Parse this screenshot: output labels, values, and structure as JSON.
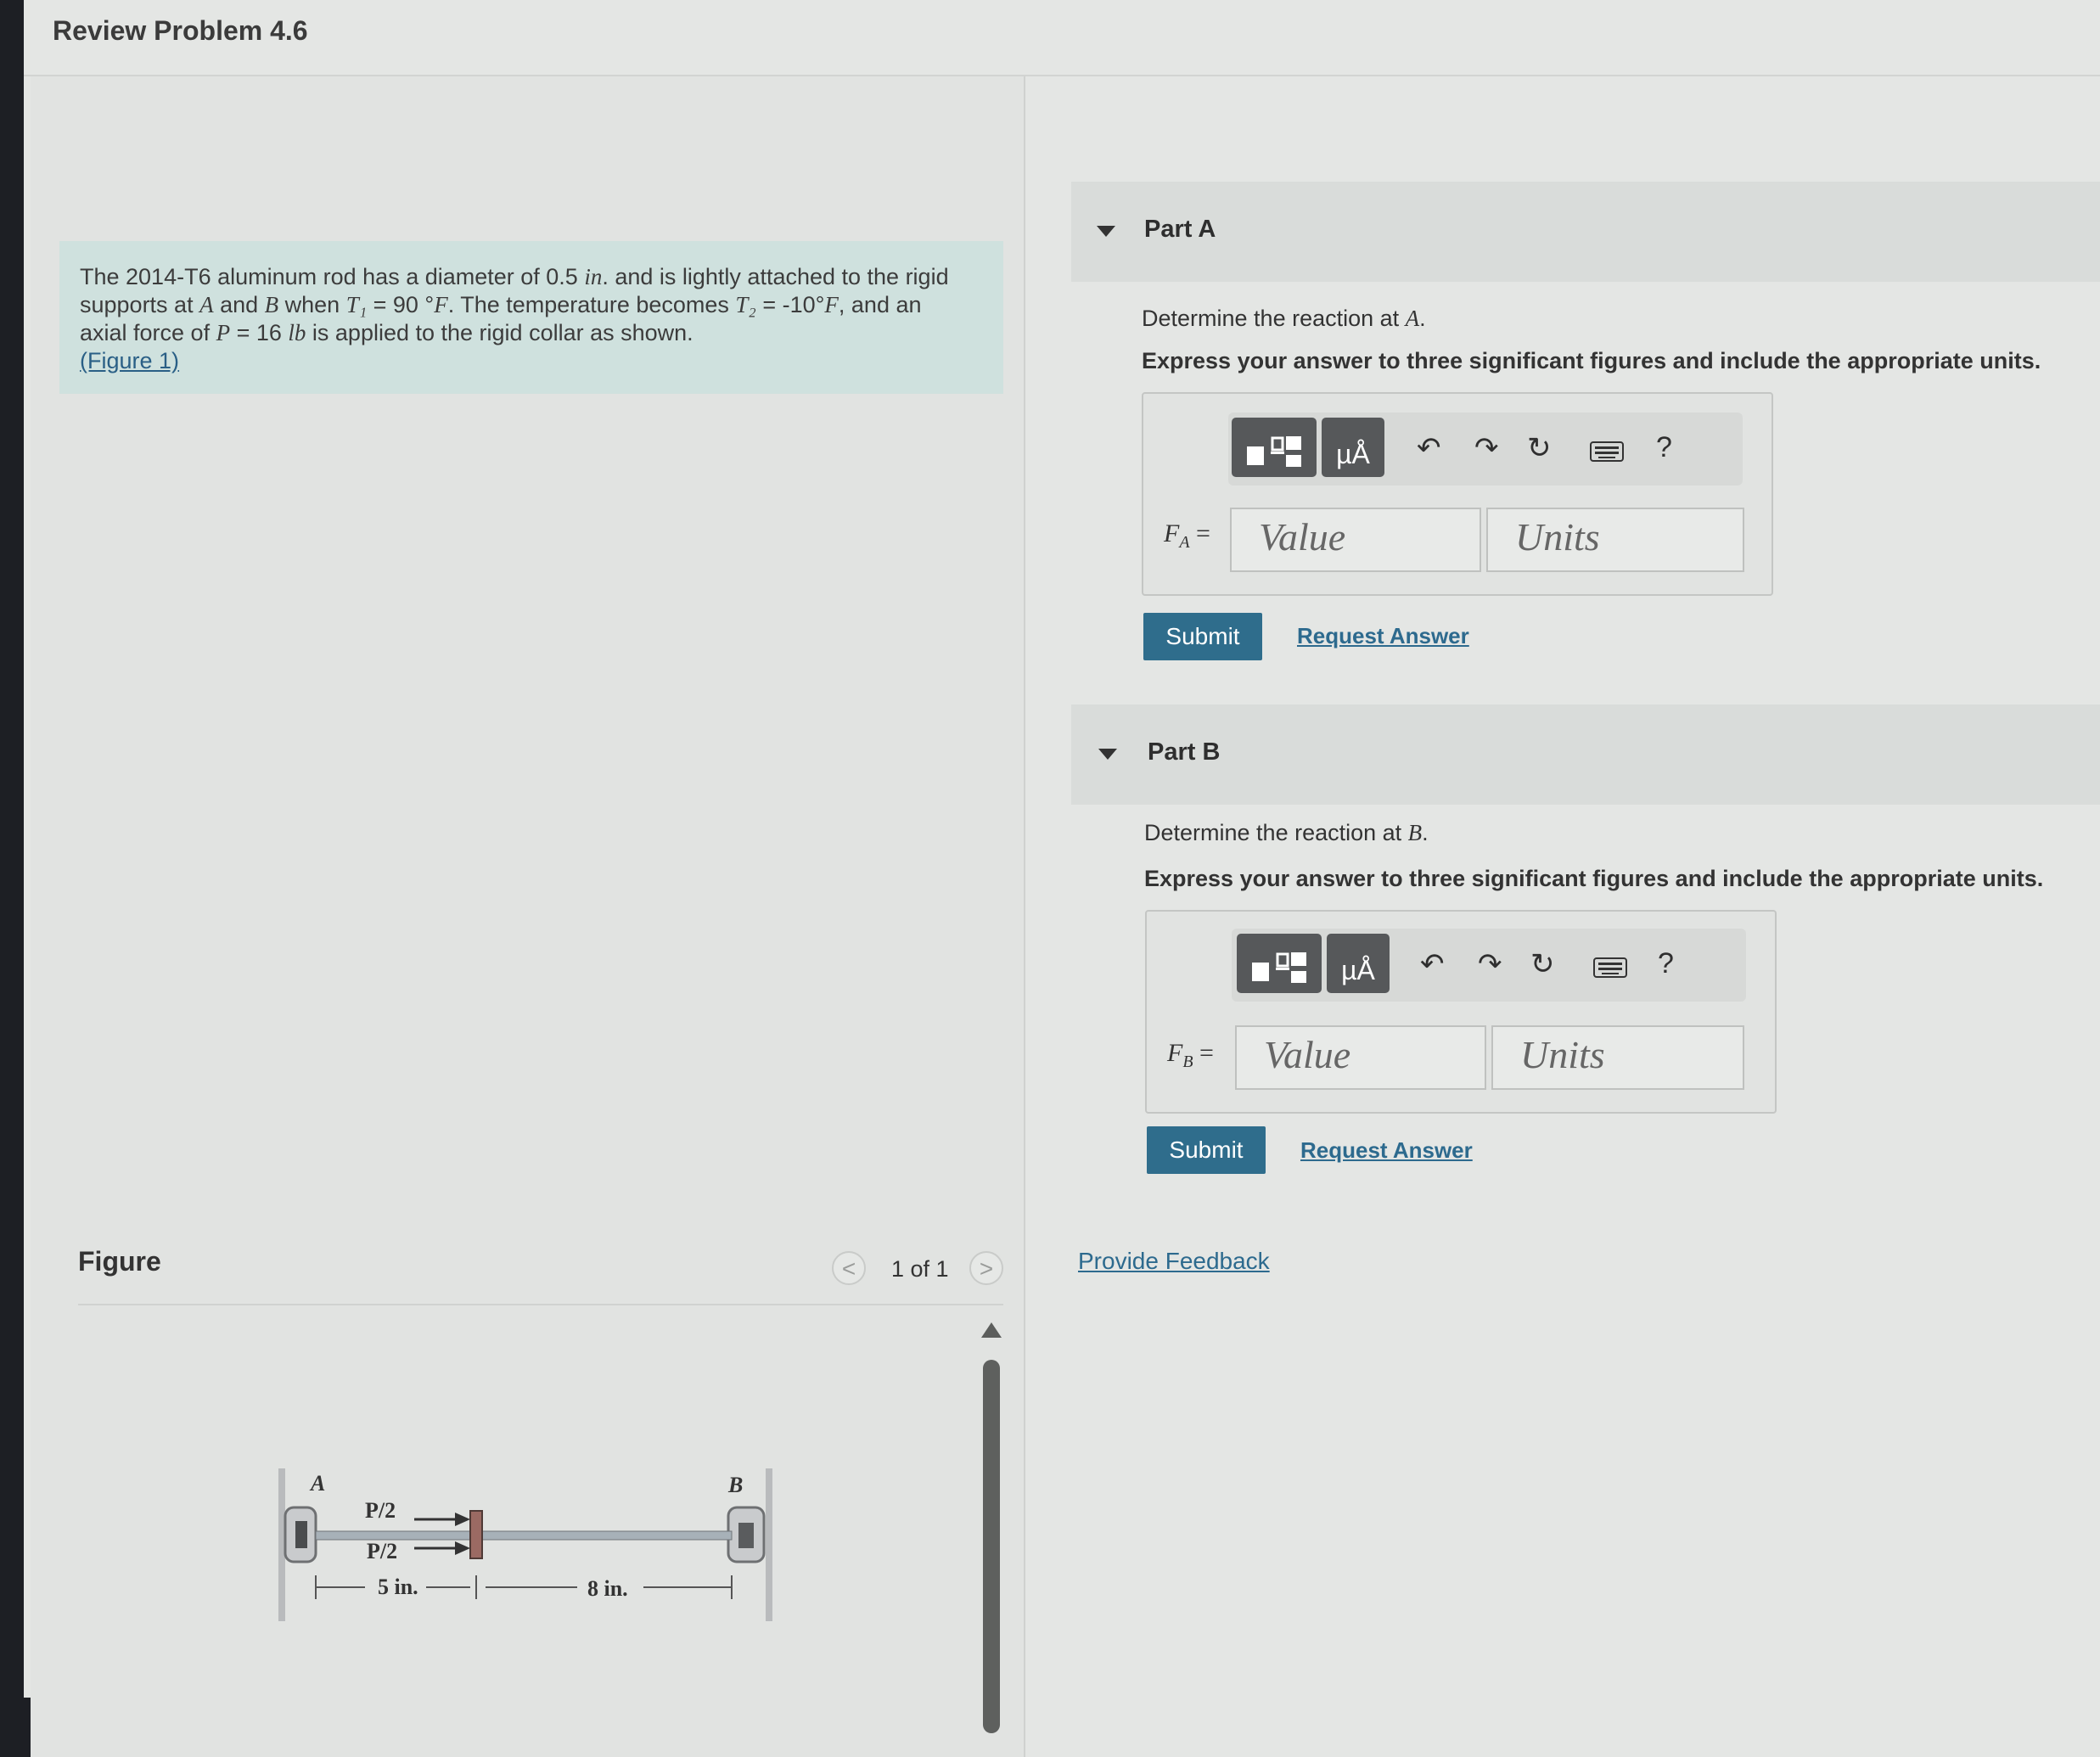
{
  "header": {
    "title": "Review Problem 4.6"
  },
  "problem": {
    "text1": "The 2014-T6 aluminum rod has a diameter of 0.5 ",
    "unit_in": "in",
    "text2": ". and is lightly attached to the rigid",
    "text3": "supports at ",
    "A": "A",
    "and": " and ",
    "B": "B",
    "when": " when ",
    "T1": "T₁",
    "t1val": " = 90 °",
    "F": "F",
    "text4": ". The temperature becomes ",
    "T2": "T₂",
    "t2val": " = -10°",
    "text5": ", and an",
    "text6": "axial force of ",
    "P": "P",
    "pval": " = 16 ",
    "lb": "lb",
    "text7": " is applied to the rigid collar as shown.",
    "figure_link": "(Figure 1)"
  },
  "figure": {
    "label": "Figure",
    "pager": "1 of 1",
    "prev": "<",
    "next": ">",
    "labels": {
      "A": "A",
      "B": "B",
      "p_top": "P/2",
      "p_bottom": "P/2",
      "dim1": "5 in.",
      "dim2": "8 in."
    }
  },
  "parts": [
    {
      "label": "Part A",
      "prompt_text": "Determine the reaction at ",
      "prompt_var": "A",
      "prompt_end": ".",
      "instruction": "Express your answer to three significant figures and include the appropriate units.",
      "eq_var": "F",
      "eq_sub": "A",
      "eq_sign": " =",
      "value_placeholder": "Value",
      "units_placeholder": "Units",
      "submit": "Submit",
      "request": "Request Answer"
    },
    {
      "label": "Part B",
      "prompt_text": "Determine the reaction at ",
      "prompt_var": "B",
      "prompt_end": ".",
      "instruction": "Express your answer to three significant figures and include the appropriate units.",
      "eq_var": "F",
      "eq_sub": "B",
      "eq_sign": " =",
      "value_placeholder": "Value",
      "units_placeholder": "Units",
      "submit": "Submit",
      "request": "Request Answer"
    }
  ],
  "toolbar": {
    "units_glyph": "µÅ",
    "help": "?"
  },
  "feedback": "Provide Feedback"
}
